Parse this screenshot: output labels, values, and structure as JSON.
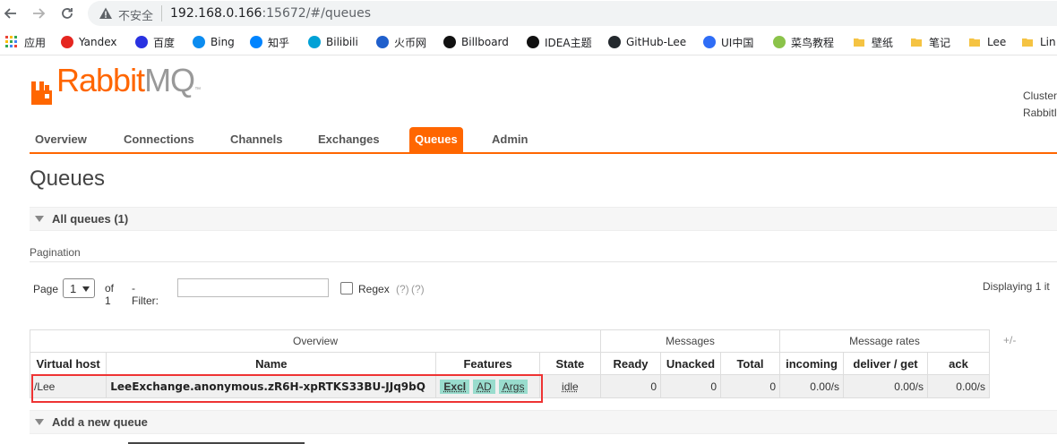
{
  "browser": {
    "insecure_label": "不安全",
    "url_host": "192.168.0.166",
    "url_rest": ":15672/#/queues",
    "bookmarks": [
      {
        "label": "应用",
        "icon": "apps-grid-icon"
      },
      {
        "label": "Yandex",
        "icon": "yandex-icon",
        "color": "#e52620"
      },
      {
        "label": "百度",
        "icon": "baidu-icon",
        "color": "#2932e1"
      },
      {
        "label": "Bing",
        "icon": "bing-icon",
        "color": "#0c8cf0"
      },
      {
        "label": "知乎",
        "icon": "zhihu-icon",
        "color": "#0084ff"
      },
      {
        "label": "Bilibili",
        "icon": "bilibili-icon",
        "color": "#00a1d6"
      },
      {
        "label": "火币网",
        "icon": "huobi-icon",
        "color": "#1f5fcc"
      },
      {
        "label": "Billboard",
        "icon": "billboard-icon",
        "color": "#111111"
      },
      {
        "label": "IDEA主题",
        "icon": "jetbrains-icon",
        "color": "#111111"
      },
      {
        "label": "GitHub-Lee",
        "icon": "github-icon",
        "color": "#24292e"
      },
      {
        "label": "UI中国",
        "icon": "ui-china-icon",
        "color": "#2f6df6"
      },
      {
        "label": "菜鸟教程",
        "icon": "runoob-icon",
        "color": "#8bc34a"
      },
      {
        "label": "壁纸",
        "icon": "folder-icon",
        "color": "#f5c342"
      },
      {
        "label": "笔记",
        "icon": "folder-icon",
        "color": "#f5c342"
      },
      {
        "label": "Lee",
        "icon": "folder-icon",
        "color": "#f5c342"
      },
      {
        "label": "Lin",
        "icon": "folder-icon",
        "color": "#f5c342"
      }
    ]
  },
  "header": {
    "logo_rabbit": "Rabbit",
    "logo_mq": "MQ",
    "logo_tm": "™",
    "cluster_line1": "Cluster",
    "cluster_line2": "RabbitI"
  },
  "tabs": [
    {
      "label": "Overview",
      "active": false
    },
    {
      "label": "Connections",
      "active": false
    },
    {
      "label": "Channels",
      "active": false
    },
    {
      "label": "Exchanges",
      "active": false
    },
    {
      "label": "Queues",
      "active": true
    },
    {
      "label": "Admin",
      "active": false
    }
  ],
  "page_title": "Queues",
  "all_queues_label": "All queues (1)",
  "pagination": {
    "heading": "Pagination",
    "page_label": "Page",
    "page_value": "1",
    "of_label": "of 1",
    "filter_label": "- Filter:",
    "filter_value": "",
    "regex_label": "Regex",
    "help1": "(?)",
    "help2": "(?)",
    "displaying": "Displaying 1 it"
  },
  "table": {
    "groups": {
      "overview": "Overview",
      "messages": "Messages",
      "rates": "Message rates",
      "plus_minus": "+/-"
    },
    "columns": [
      "Virtual host",
      "Name",
      "Features",
      "State",
      "Ready",
      "Unacked",
      "Total",
      "incoming",
      "deliver / get",
      "ack"
    ],
    "rows": [
      {
        "vhost": "/Lee",
        "name": "LeeExchange.anonymous.zR6H-xpRTKS33BU-JJq9bQ",
        "features": [
          "Excl",
          "AD",
          "Args"
        ],
        "state": "idle",
        "ready": "0",
        "unacked": "0",
        "total": "0",
        "incoming": "0.00/s",
        "deliver_get": "0.00/s",
        "ack": "0.00/s"
      }
    ]
  },
  "add_queue_label": "Add a new queue",
  "colors": {
    "accent": "#ff6600",
    "tag": "#99dccd",
    "highlight": "#ee3333"
  }
}
